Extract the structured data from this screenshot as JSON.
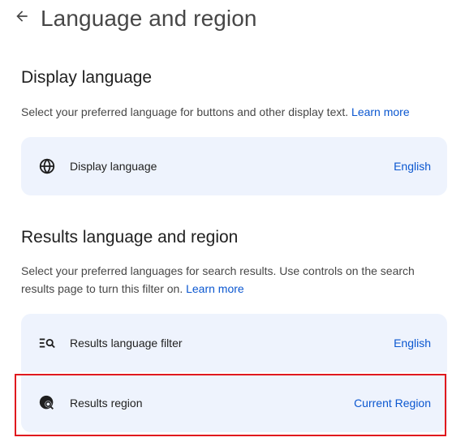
{
  "header": {
    "title": "Language and region",
    "back_icon": "arrow-left-icon"
  },
  "display_section": {
    "title": "Display language",
    "description": "Select your preferred language for buttons and other display text.",
    "learn_more": "Learn more",
    "rows": [
      {
        "icon": "globe-icon",
        "label": "Display language",
        "value": "English"
      }
    ]
  },
  "results_section": {
    "title": "Results language and region",
    "description": "Select your preferred languages for search results. Use controls on the search results page to turn this filter on.",
    "learn_more": "Learn more",
    "rows": [
      {
        "icon": "filter-search-icon",
        "label": "Results language filter",
        "value": "English"
      },
      {
        "icon": "globe-search-icon",
        "label": "Results region",
        "value": "Current Region"
      }
    ]
  },
  "colors": {
    "accent": "#0b57d0",
    "card_background": "#eef3fd",
    "highlight_border": "#e0191e"
  }
}
